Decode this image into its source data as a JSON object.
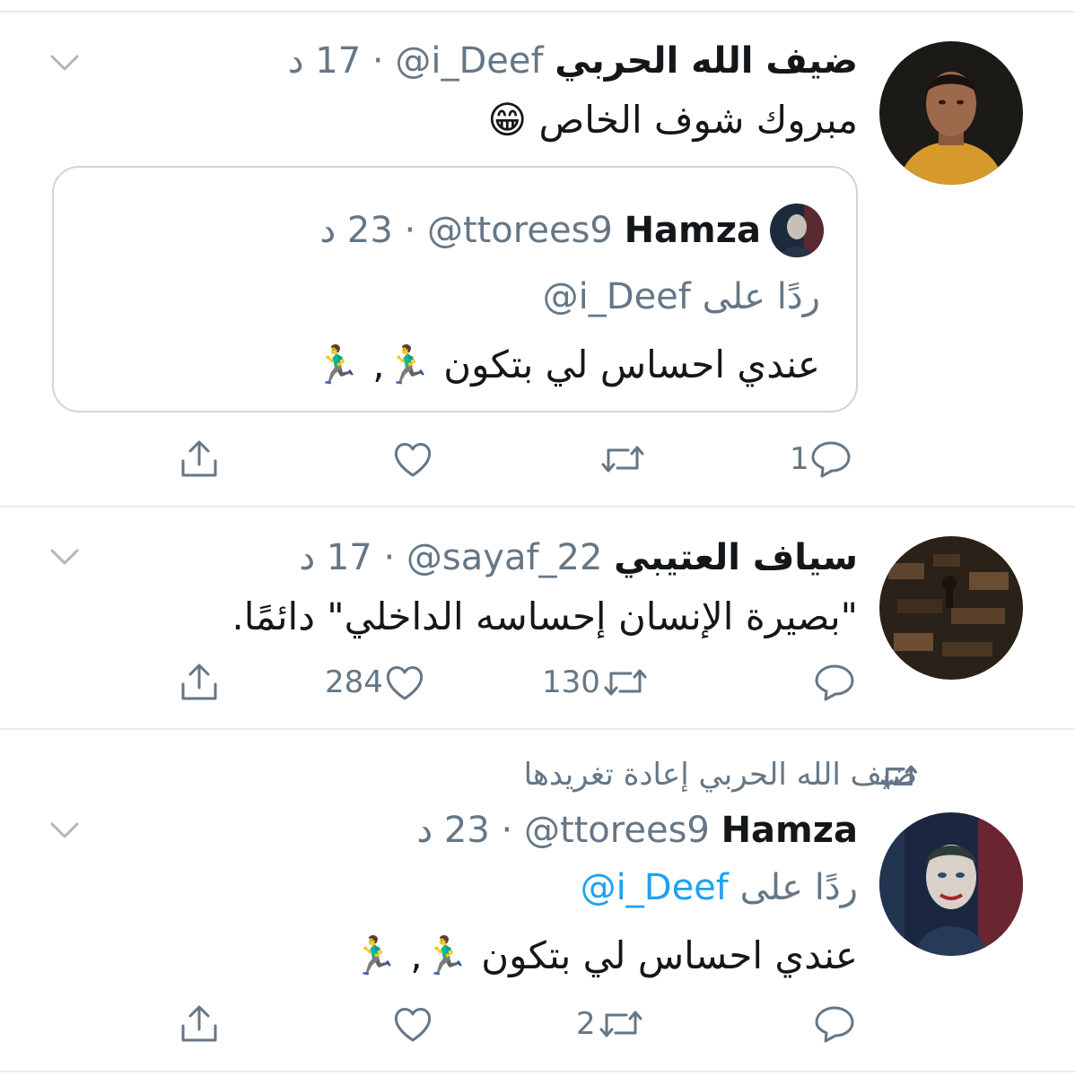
{
  "tweets": [
    {
      "display_name": "ضيف الله الحربي",
      "handle": "@i_Deef",
      "sep": "·",
      "time": "17 د",
      "text": "مبروك شوف الخاص 😁",
      "quote": {
        "display_name": "Hamza",
        "handle": "@ttorees9",
        "sep": "·",
        "time": "23 د",
        "reply_prefix": "ردًا على",
        "reply_to": "@i_Deef",
        "text": "عندي احساس لي بتكون 🏃‍♂️, 🏃‍♂️"
      },
      "actions": {
        "reply_count": "1",
        "retweet_count": "",
        "like_count": ""
      }
    },
    {
      "display_name": "سياف العتيبي",
      "handle": "@sayaf_22",
      "sep": "·",
      "time": "17 د",
      "text": "\"بصيرة الإنسان إحساسه الداخلي\" دائمًا.",
      "actions": {
        "reply_count": "",
        "retweet_count": "130",
        "like_count": "284"
      }
    },
    {
      "retweeted_by": "ضيف الله الحربي إعادة تغريدها",
      "display_name": "Hamza",
      "handle": "@ttorees9",
      "sep": "·",
      "time": "23 د",
      "reply_prefix": "ردًا على",
      "reply_to": "@i_Deef",
      "text": "عندي احساس لي بتكون 🏃‍♂️, 🏃‍♂️",
      "actions": {
        "reply_count": "",
        "retweet_count": "2",
        "like_count": ""
      }
    }
  ],
  "icons": {
    "reply": "reply-icon",
    "retweet": "retweet-icon",
    "like": "heart-icon",
    "share": "share-icon",
    "menu": "chevron-down-icon"
  },
  "colors": {
    "text": "#14171a",
    "muted": "#657786",
    "link": "#1da1f2",
    "divider": "#e6ecf0"
  }
}
